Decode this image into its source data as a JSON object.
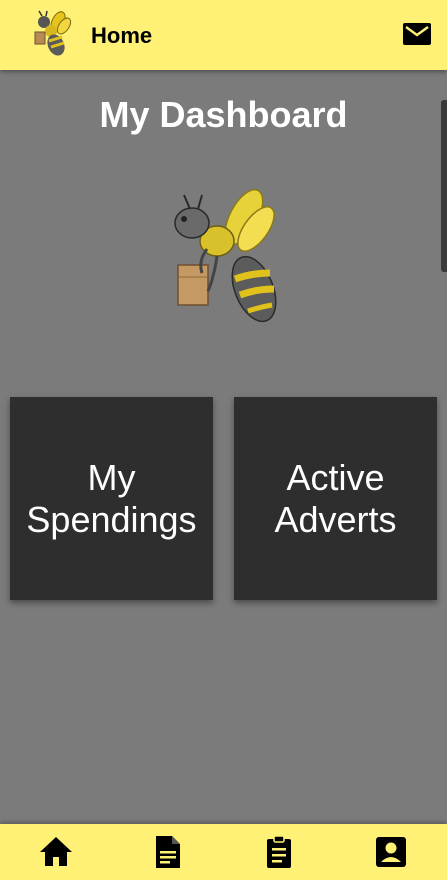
{
  "topbar": {
    "title": "Home",
    "logo_icon": "bee-mascot-logo",
    "mail_icon": "mail-icon",
    "background": "#fff176"
  },
  "dashboard": {
    "title": "My Dashboard",
    "mascot_icon": "bee-carrying-box-illustration",
    "cards": [
      {
        "line1": "My",
        "line2": "Spendings"
      },
      {
        "line1": "Active",
        "line2": "Adverts"
      }
    ]
  },
  "bottom_nav": {
    "items": [
      "home-icon",
      "document-icon",
      "clipboard-icon",
      "account-box-icon"
    ]
  },
  "colors": {
    "accent": "#fff176",
    "background": "#7b7b7b",
    "card": "#2e2e2e"
  }
}
